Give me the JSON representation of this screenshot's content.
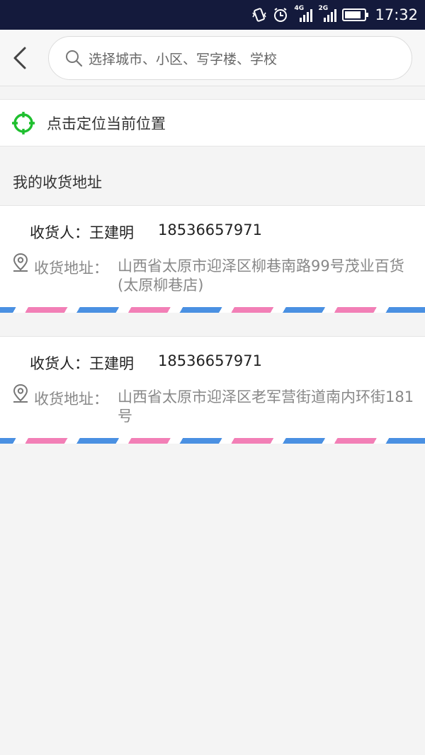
{
  "status_bar": {
    "time": "17:32",
    "network_a": "4G",
    "network_b": "2G",
    "icons": [
      "vibrate-icon",
      "alarm-icon",
      "signal-icon",
      "signal-icon",
      "battery-icon"
    ]
  },
  "header": {
    "back_icon": "chevron-left-icon",
    "search_icon": "search-icon",
    "search_placeholder": "选择城市、小区、写字楼、学校"
  },
  "locate": {
    "icon": "locate-crosshair-icon",
    "label": "点击定位当前位置",
    "icon_color": "#1fbf2f"
  },
  "section_title": "我的收货地址",
  "addresses": [
    {
      "receiver_label": "收货人：",
      "name": "王建明",
      "phone": "18536657971",
      "address_label": "收货地址：",
      "address": "山西省太原市迎泽区柳巷南路99号茂业百货(太原柳巷店)"
    },
    {
      "receiver_label": "收货人：",
      "name": "王建明",
      "phone": "18536657971",
      "address_label": "收货地址：",
      "address": "山西省太原市迎泽区老军营街道南内环街181号"
    }
  ],
  "colors": {
    "status_bar": "#141a3c",
    "stripe_blue": "#4a90e2",
    "stripe_pink": "#f27fb6"
  }
}
